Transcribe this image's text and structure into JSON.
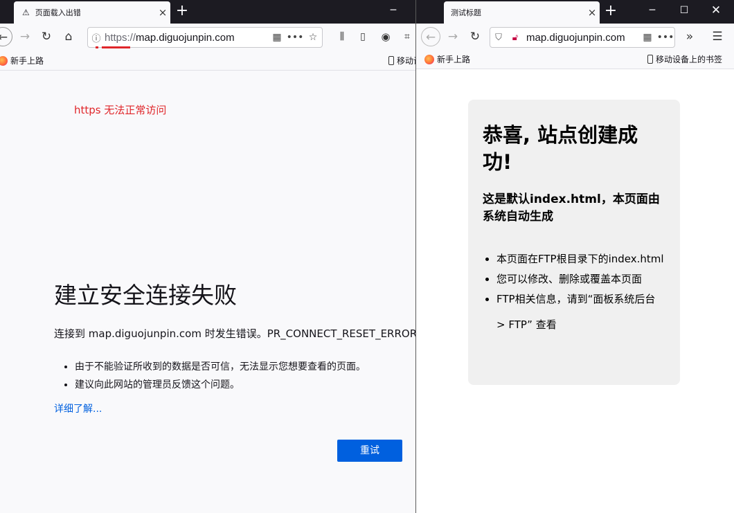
{
  "left": {
    "tab_title": "页面载入出错",
    "url_scheme": "https://",
    "url_host": "map.diguojunpin.com",
    "bookmark_new": "新手上路",
    "bookmark_mobile": "移动设",
    "annotation": "https 无法正常访问",
    "error_title": "建立安全连接失败",
    "error_desc": "连接到 map.diguojunpin.com 时发生错误。PR_CONNECT_RESET_ERROR",
    "error_items": [
      "由于不能验证所收到的数据是否可信，无法显示您想要查看的页面。",
      "建议向此网站的管理员反馈这个问题。"
    ],
    "learn_more": "详细了解...",
    "retry": "重试"
  },
  "right": {
    "tab_title": "测试标题",
    "url": "map.diguojunpin.com",
    "bookmark_new": "新手上路",
    "bookmark_mobile": "移动设备上的书签",
    "heading": "恭喜, 站点创建成功!",
    "subheading": "这是默认index.html，本页面由系统自动生成",
    "items": [
      "本页面在FTP根目录下的index.html",
      "您可以修改、删除或覆盖本页面",
      "FTP相关信息，请到“面板系统后台 > FTP” 查看"
    ]
  },
  "colors": {
    "annotation": "#e0262a",
    "link": "#0060df",
    "primary_button": "#0060df",
    "tabbar": "#1c1b22"
  }
}
